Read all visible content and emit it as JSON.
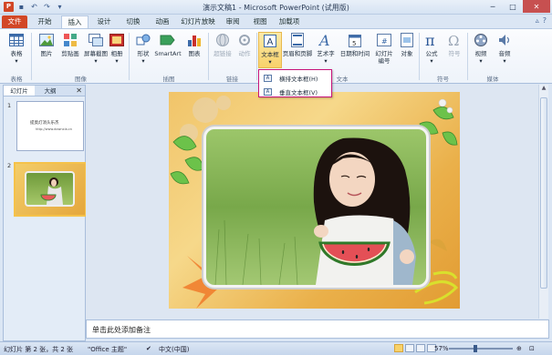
{
  "window": {
    "title": "演示文稿1 - Microsoft PowerPoint (试用版)"
  },
  "ribbon_tabs": [
    "文件",
    "开始",
    "插入",
    "设计",
    "切换",
    "动画",
    "幻灯片放映",
    "审阅",
    "视图",
    "加载项"
  ],
  "groups": {
    "tables": "表格",
    "images": "图像",
    "illustrations": "插图",
    "links": "链接",
    "text": "文本",
    "symbols": "符号",
    "media": "媒体"
  },
  "buttons": {
    "table": "表格",
    "picture": "图片",
    "clipart": "剪贴画",
    "screenshot": "屏幕截图",
    "album": "相册",
    "shapes": "形状",
    "smartart": "SmartArt",
    "chart": "图表",
    "hyperlink": "超链接",
    "action": "动作",
    "textbox": "文本框",
    "header_footer": "页眉和页脚",
    "wordart": "艺术字",
    "datetime": "日期和时间",
    "slide_number": "幻灯片",
    "slide_number_2": "编号",
    "object": "对象",
    "equation": "公式",
    "symbol": "符号",
    "video": "视频",
    "audio": "音频"
  },
  "textbox_menu": [
    "横排文本框(H)",
    "垂直文本框(V)"
  ],
  "left_pane": {
    "tabs": [
      "幻灯片",
      "大纲"
    ],
    "slide_numbers": [
      "1",
      "2"
    ],
    "thumb1_title": "提莫灯消头乐杰",
    "thumb1_sub": "http://www.downxia.cn"
  },
  "notes_placeholder": "单击此处添加备注",
  "status": {
    "slide_info": "幻灯片 第 2 张，共 2 张",
    "theme": "\"Office 主题\"",
    "language": "中文(中国)",
    "zoom": "57%"
  },
  "colors": {
    "file_tab": "#d24726",
    "ribbon_accent": "#f8d26a",
    "dropdown_border": "#c8147a"
  }
}
